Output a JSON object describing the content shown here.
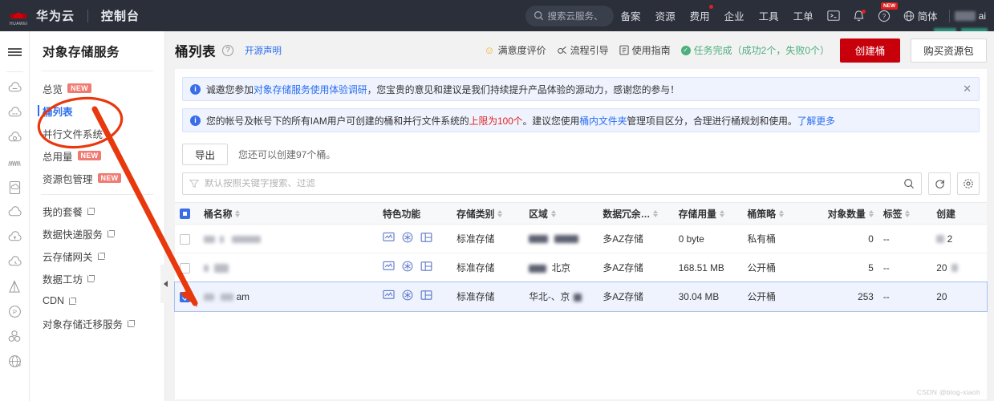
{
  "topnav": {
    "brand": "华为云",
    "console": "控制台",
    "search_placeholder": "搜索云服务、",
    "links": [
      {
        "label": "备案",
        "dot": false
      },
      {
        "label": "资源",
        "dot": false
      },
      {
        "label": "费用",
        "dot": true
      },
      {
        "label": "企业",
        "dot": false
      },
      {
        "label": "工具",
        "dot": false
      },
      {
        "label": "工单",
        "dot": false
      }
    ],
    "icons": [
      {
        "name": "cloudshell-icon",
        "glyph": "[_>",
        "badge": ""
      },
      {
        "name": "notification-bell-icon",
        "glyph": "bell",
        "badge": ""
      },
      {
        "name": "help-question-icon",
        "glyph": "?",
        "badge": "NEW"
      }
    ],
    "lang": "简体",
    "ai_label": "ai"
  },
  "rail": {
    "menu_icon": "hamburger-menu-icon",
    "items": [
      "cloud-service-icon-1",
      "cloud-service-icon-2",
      "cloud-service-icon-3",
      "waveform-icon",
      "document-cloud-icon",
      "cloud-icon",
      "cloud-upload-icon",
      "cloud-clock-icon",
      "pyramid-icon",
      "globe-p-icon",
      "cluster-icon",
      "globe-w-icon"
    ]
  },
  "sidebar": {
    "service_title": "对象存储服务",
    "items": [
      {
        "label": "总览",
        "tag": "NEW",
        "external": false,
        "active": false
      },
      {
        "label": "桶列表",
        "tag": "",
        "external": false,
        "active": true
      },
      {
        "label": "并行文件系统",
        "tag": "",
        "external": false,
        "active": false
      },
      {
        "label": "总用量",
        "tag": "NEW",
        "external": false,
        "active": false
      },
      {
        "label": "资源包管理",
        "tag": "NEW",
        "external": false,
        "active": false
      }
    ],
    "items2": [
      {
        "label": "我的套餐",
        "tag": "",
        "external": true,
        "active": false
      },
      {
        "label": "数据快递服务",
        "tag": "",
        "external": true,
        "active": false
      },
      {
        "label": "云存储网关",
        "tag": "",
        "external": true,
        "active": false
      },
      {
        "label": "数据工坊",
        "tag": "",
        "external": true,
        "active": false
      },
      {
        "label": "CDN",
        "tag": "",
        "external": true,
        "active": false
      },
      {
        "label": "对象存储迁移服务",
        "tag": "",
        "external": true,
        "active": false
      }
    ]
  },
  "page": {
    "title": "桶列表",
    "help_glyph": "?",
    "opensource_link": "开源声明",
    "actions": [
      {
        "name": "satisfaction-rating",
        "icon": "smiley-icon",
        "label": "满意度评价"
      },
      {
        "name": "process-guide",
        "icon": "guide-icon",
        "label": "流程引导"
      },
      {
        "name": "user-guide",
        "icon": "book-icon",
        "label": "使用指南"
      }
    ],
    "task_status": "任务完成（成功2个，失败0个）",
    "create_bucket": "创建桶",
    "buy_package": "购买资源包"
  },
  "alerts": [
    {
      "parts": [
        {
          "t": "诚邀您参加",
          "style": "plain"
        },
        {
          "t": "对象存储服务使用体验调研",
          "style": "link"
        },
        {
          "t": "，您宝贵的意见和建议是我们持续提升产品体验的源动力，感谢您的参与！",
          "style": "plain"
        }
      ],
      "closable": true
    },
    {
      "parts": [
        {
          "t": "您的帐号及帐号下的所有IAM用户可创建的桶和并行文件系统的",
          "style": "plain"
        },
        {
          "t": "上限为100个",
          "style": "warn"
        },
        {
          "t": "。建议您使用",
          "style": "plain"
        },
        {
          "t": "桶内文件夹",
          "style": "link"
        },
        {
          "t": "管理项目区分，合理进行桶规划和使用。",
          "style": "plain"
        },
        {
          "t": "了解更多",
          "style": "link"
        }
      ],
      "closable": false
    }
  ],
  "toolbar": {
    "export_label": "导出",
    "quota_text": "您还可以创建97个桶。",
    "search_placeholder": "默认按照关键字搜索、过滤",
    "filter_icon": "filter-icon",
    "search_icon": "search-icon",
    "refresh_icon": "refresh-icon",
    "settings_icon": "gear-icon"
  },
  "table": {
    "columns": [
      {
        "key": "name",
        "label": "桶名称",
        "sortable": true,
        "align": "left"
      },
      {
        "key": "feature",
        "label": "特色功能",
        "sortable": false,
        "align": "left"
      },
      {
        "key": "storage",
        "label": "存储类别",
        "sortable": true,
        "align": "left"
      },
      {
        "key": "region",
        "label": "区域",
        "sortable": true,
        "align": "left"
      },
      {
        "key": "redundancy",
        "label": "数据冗余…",
        "sortable": true,
        "align": "left"
      },
      {
        "key": "usage",
        "label": "存储用量",
        "sortable": true,
        "align": "left"
      },
      {
        "key": "policy",
        "label": "桶策略",
        "sortable": true,
        "align": "left"
      },
      {
        "key": "objects",
        "label": "对象数量",
        "sortable": true,
        "align": "right"
      },
      {
        "key": "tags",
        "label": "标签",
        "sortable": true,
        "align": "left"
      },
      {
        "key": "created",
        "label": "创建",
        "sortable": false,
        "align": "left"
      }
    ],
    "feature_icons": [
      "monitor-icon",
      "snowflake-icon",
      "table-icon"
    ],
    "rows": [
      {
        "selected": false,
        "name": "",
        "name_redacted": true,
        "storage": "标准存储",
        "region": "",
        "region_redacted": true,
        "redundancy": "多AZ存储",
        "usage": "0 byte",
        "policy": "私有桶",
        "policy_public": false,
        "objects": "0",
        "tags": "--",
        "created": "2",
        "created_redacted": true
      },
      {
        "selected": false,
        "name": "",
        "name_redacted": true,
        "storage": "标准存储",
        "region": "华北-北京",
        "region_redacted": true,
        "redundancy": "多AZ存储",
        "usage": "168.51 MB",
        "policy": "公开桶",
        "policy_public": true,
        "objects": "5",
        "tags": "--",
        "created": "20",
        "created_redacted": true
      },
      {
        "selected": true,
        "name": "am",
        "name_redacted": true,
        "storage": "标准存储",
        "region": "华北-北京",
        "region_redacted": true,
        "redundancy": "多AZ存储",
        "usage": "30.04 MB",
        "policy": "公开桶",
        "policy_public": true,
        "objects": "253",
        "tags": "--",
        "created": "20",
        "created_redacted": true
      }
    ]
  },
  "watermark": "CSDN @blog-xiaoh",
  "colors": {
    "brand_red": "#c7000b",
    "link_blue": "#2a6ef0",
    "annotation_red": "#e8380d",
    "success_green": "#4caf7d",
    "public_orange": "#e05c4e"
  }
}
